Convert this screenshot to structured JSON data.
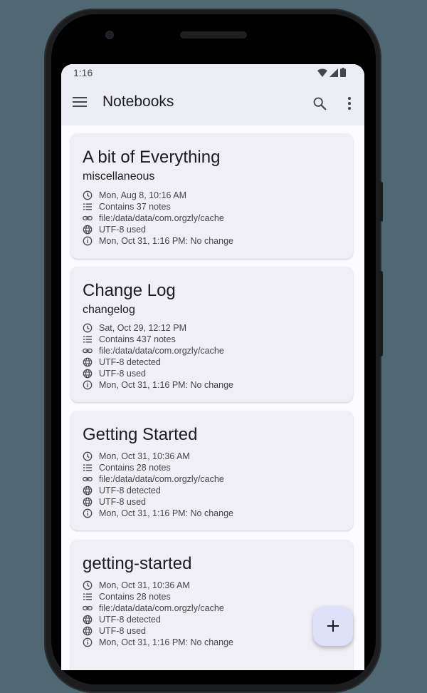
{
  "status": {
    "time": "1:16"
  },
  "appbar": {
    "title": "Notebooks"
  },
  "notebooks": [
    {
      "title": "A bit of Everything",
      "subtitle": "miscellaneous",
      "details": [
        {
          "icon": "clock-icon",
          "text": "Mon, Aug 8, 10:16 AM"
        },
        {
          "icon": "list-icon",
          "text": "Contains 37 notes"
        },
        {
          "icon": "link-icon",
          "text": "file:/data/data/com.orgzly/cache"
        },
        {
          "icon": "globe-icon",
          "text": "UTF-8 used"
        },
        {
          "icon": "info-icon",
          "text": "Mon, Oct 31, 1:16 PM: No change"
        }
      ]
    },
    {
      "title": "Change Log",
      "subtitle": "changelog",
      "details": [
        {
          "icon": "clock-icon",
          "text": "Sat, Oct 29, 12:12 PM"
        },
        {
          "icon": "list-icon",
          "text": "Contains 437 notes"
        },
        {
          "icon": "link-icon",
          "text": "file:/data/data/com.orgzly/cache"
        },
        {
          "icon": "globe-icon",
          "text": "UTF-8 detected"
        },
        {
          "icon": "globe-icon",
          "text": "UTF-8 used"
        },
        {
          "icon": "info-icon",
          "text": "Mon, Oct 31, 1:16 PM: No change"
        }
      ]
    },
    {
      "title": "Getting Started",
      "subtitle": "",
      "details": [
        {
          "icon": "clock-icon",
          "text": "Mon, Oct 31, 10:36 AM"
        },
        {
          "icon": "list-icon",
          "text": "Contains 28 notes"
        },
        {
          "icon": "link-icon",
          "text": "file:/data/data/com.orgzly/cache"
        },
        {
          "icon": "globe-icon",
          "text": "UTF-8 detected"
        },
        {
          "icon": "globe-icon",
          "text": "UTF-8 used"
        },
        {
          "icon": "info-icon",
          "text": "Mon, Oct 31, 1:16 PM: No change"
        }
      ]
    },
    {
      "title": "getting-started",
      "subtitle": "",
      "details": [
        {
          "icon": "clock-icon",
          "text": "Mon, Oct 31, 10:36 AM"
        },
        {
          "icon": "list-icon",
          "text": "Contains 28 notes"
        },
        {
          "icon": "link-icon",
          "text": "file:/data/data/com.orgzly/cache"
        },
        {
          "icon": "globe-icon",
          "text": "UTF-8 detected"
        },
        {
          "icon": "globe-icon",
          "text": "UTF-8 used"
        },
        {
          "icon": "info-icon",
          "text": "Mon, Oct 31, 1:16 PM: No change"
        }
      ]
    }
  ],
  "fab": {
    "icon": "plus-icon"
  },
  "colors": {
    "background": "#4f6872",
    "appbar": "#ececf4",
    "card": "#f0eff5",
    "fab": "#dfe1f9"
  }
}
